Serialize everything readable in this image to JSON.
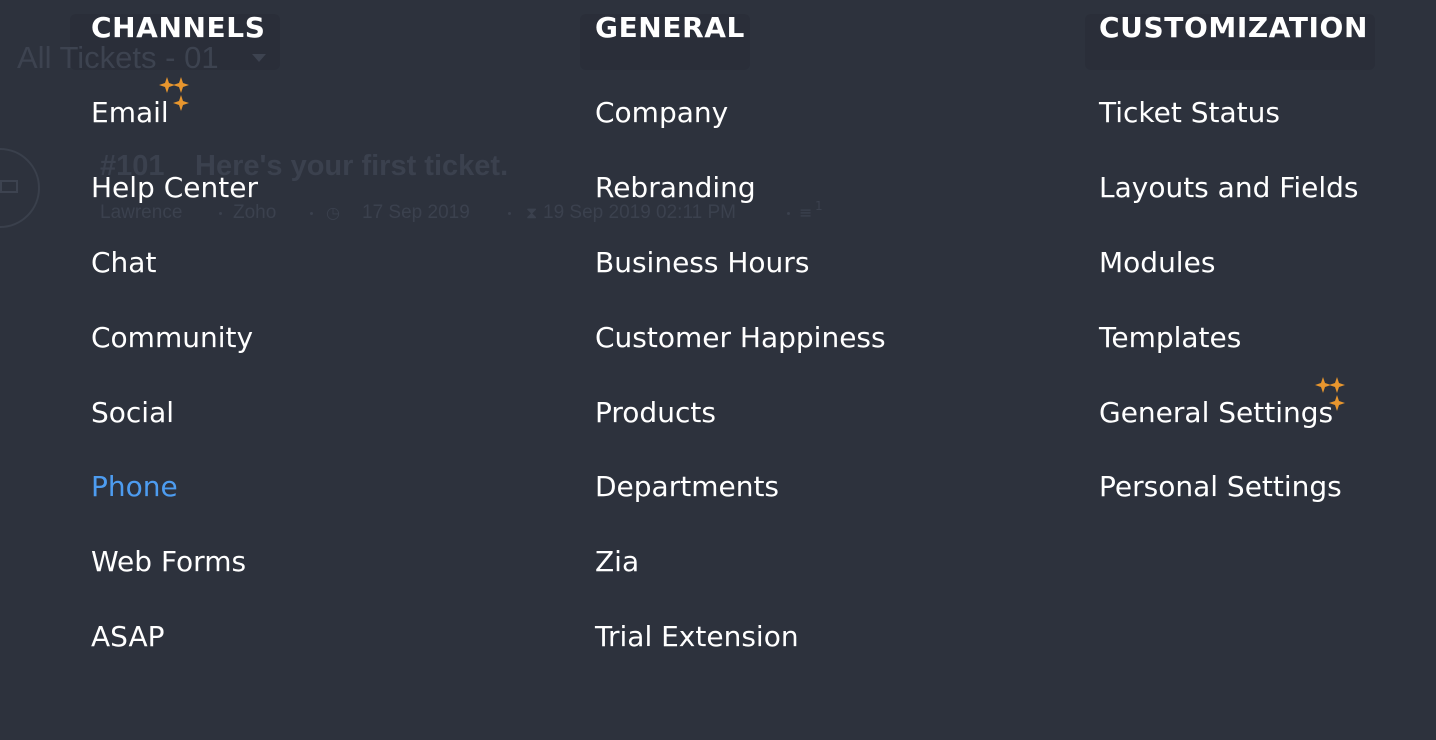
{
  "background": {
    "view_title": "All Tickets - 01",
    "ticket": {
      "id": "#101",
      "subject": "Here's your first ticket.",
      "contact": "Lawrence",
      "account": "Zoho",
      "created": "17 Sep 2019",
      "due": "19 Sep 2019 02:11 PM",
      "thread_count": "1"
    }
  },
  "menu": {
    "channels": {
      "heading": "CHANNELS",
      "items": [
        {
          "label": "Email"
        },
        {
          "label": "Help Center"
        },
        {
          "label": "Chat"
        },
        {
          "label": "Community"
        },
        {
          "label": "Social"
        },
        {
          "label": "Phone"
        },
        {
          "label": "Web Forms"
        },
        {
          "label": "ASAP"
        }
      ]
    },
    "general": {
      "heading": "GENERAL",
      "items": [
        {
          "label": "Company"
        },
        {
          "label": "Rebranding"
        },
        {
          "label": "Business Hours"
        },
        {
          "label": "Customer Happiness"
        },
        {
          "label": "Products"
        },
        {
          "label": "Departments"
        },
        {
          "label": "Zia"
        },
        {
          "label": "Trial Extension"
        }
      ]
    },
    "customization": {
      "heading": "CUSTOMIZATION",
      "items": [
        {
          "label": "Ticket Status"
        },
        {
          "label": "Layouts and Fields"
        },
        {
          "label": "Modules"
        },
        {
          "label": "Templates"
        },
        {
          "label": "General Settings"
        },
        {
          "label": "Personal Settings"
        }
      ]
    }
  },
  "colors": {
    "overlay_bg": "#2d323d",
    "text": "#ffffff",
    "active_link": "#4d9cf0",
    "sparkle": "#e8962e"
  },
  "icons": {
    "new_feature": "sparkle-icon",
    "caret": "caret-down-icon",
    "channel": "mail-icon"
  }
}
